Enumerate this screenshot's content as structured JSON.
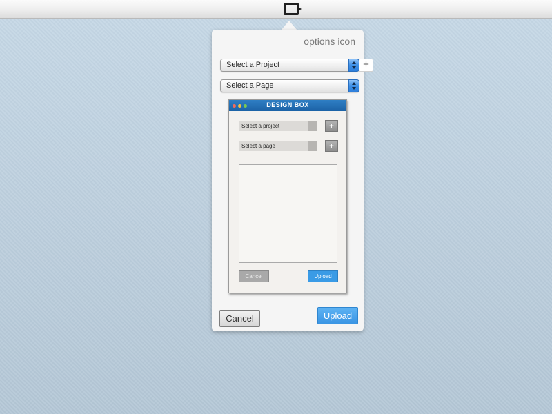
{
  "menubar": {
    "tray_icon": "app-tray-icon"
  },
  "popover": {
    "options_label": "options icon",
    "project_select": {
      "value": "Select a Project"
    },
    "page_select": {
      "value": "Select a Page"
    },
    "add_label": "+",
    "cancel_label": "Cancel",
    "upload_label": "Upload",
    "accent_color": "#3a95e4"
  },
  "mockup": {
    "title": "DESIGN BOX",
    "window_dots": [
      "#f26b5b",
      "#f6c044",
      "#77c756"
    ],
    "project_field": "Select a project",
    "page_field": "Select a page",
    "plus_label": "+",
    "cancel_label": "Cancel",
    "upload_label": "Upload"
  }
}
